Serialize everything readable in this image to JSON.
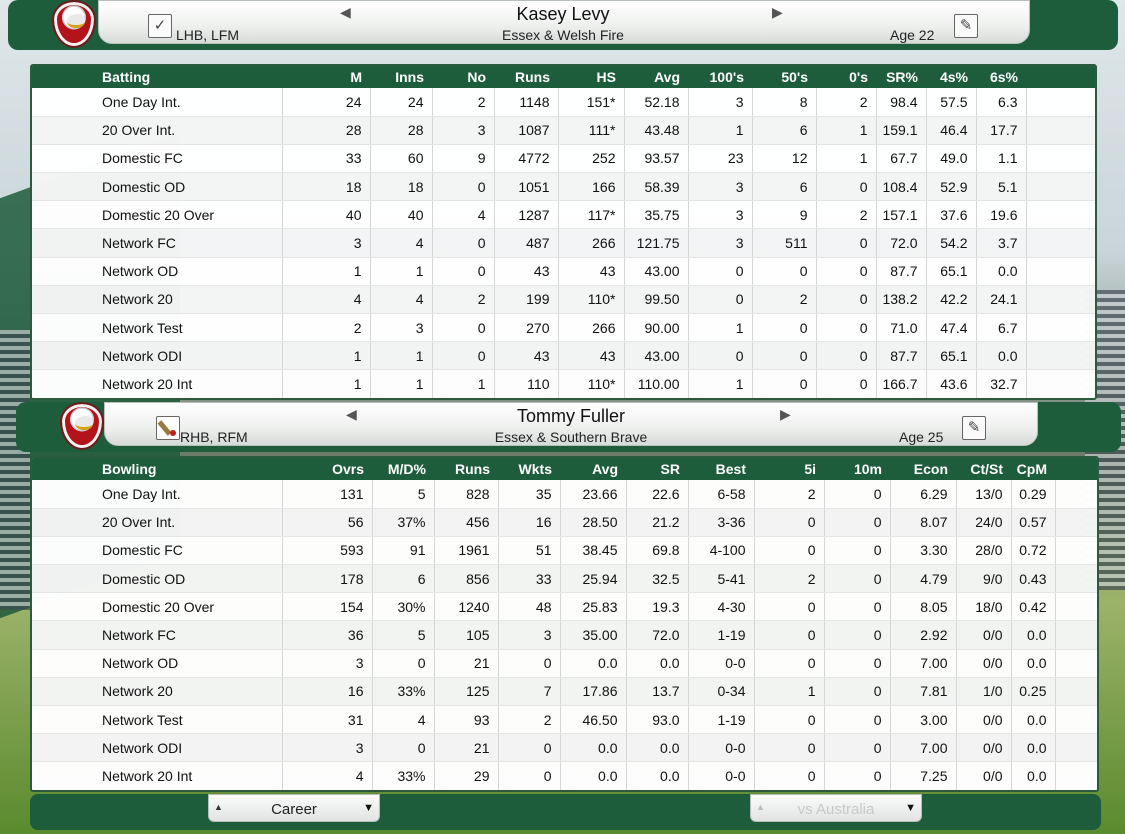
{
  "top_player": {
    "name": "Kasey Levy",
    "team": "Essex & Welsh Fire",
    "hand": "LHB, LFM",
    "age": "Age 22"
  },
  "bottom_player": {
    "name": "Tommy Fuller",
    "team": "Essex & Southern Brave",
    "hand": "RHB, RFM",
    "age": "Age 25"
  },
  "batting": {
    "headers": [
      "Batting",
      "M",
      "Inns",
      "No",
      "Runs",
      "HS",
      "Avg",
      "100's",
      "50's",
      "0's",
      "SR%",
      "4s%",
      "6s%"
    ],
    "rows": [
      [
        "One Day Int.",
        "24",
        "24",
        "2",
        "1148",
        "151*",
        "52.18",
        "3",
        "8",
        "2",
        "98.4",
        "57.5",
        "6.3"
      ],
      [
        "20 Over Int.",
        "28",
        "28",
        "3",
        "1087",
        "111*",
        "43.48",
        "1",
        "6",
        "1",
        "159.1",
        "46.4",
        "17.7"
      ],
      [
        "Domestic FC",
        "33",
        "60",
        "9",
        "4772",
        "252",
        "93.57",
        "23",
        "12",
        "1",
        "67.7",
        "49.0",
        "1.1"
      ],
      [
        "Domestic OD",
        "18",
        "18",
        "0",
        "1051",
        "166",
        "58.39",
        "3",
        "6",
        "0",
        "108.4",
        "52.9",
        "5.1"
      ],
      [
        "Domestic 20 Over",
        "40",
        "40",
        "4",
        "1287",
        "117*",
        "35.75",
        "3",
        "9",
        "2",
        "157.1",
        "37.6",
        "19.6"
      ],
      [
        "Network FC",
        "3",
        "4",
        "0",
        "487",
        "266",
        "121.75",
        "3",
        "511",
        "0",
        "72.0",
        "54.2",
        "3.7"
      ],
      [
        "Network OD",
        "1",
        "1",
        "0",
        "43",
        "43",
        "43.00",
        "0",
        "0",
        "0",
        "87.7",
        "65.1",
        "0.0"
      ],
      [
        "Network 20",
        "4",
        "4",
        "2",
        "199",
        "110*",
        "99.50",
        "0",
        "2",
        "0",
        "138.2",
        "42.2",
        "24.1"
      ],
      [
        "Network Test",
        "2",
        "3",
        "0",
        "270",
        "266",
        "90.00",
        "1",
        "0",
        "0",
        "71.0",
        "47.4",
        "6.7"
      ],
      [
        "Network ODI",
        "1",
        "1",
        "0",
        "43",
        "43",
        "43.00",
        "0",
        "0",
        "0",
        "87.7",
        "65.1",
        "0.0"
      ],
      [
        "Network 20 Int",
        "1",
        "1",
        "1",
        "110",
        "110*",
        "110.00",
        "1",
        "0",
        "0",
        "166.7",
        "43.6",
        "32.7"
      ]
    ]
  },
  "bowling": {
    "headers": [
      "Bowling",
      "Ovrs",
      "M/D%",
      "Runs",
      "Wkts",
      "Avg",
      "SR",
      "Best",
      "5i",
      "10m",
      "Econ",
      "Ct/St",
      "CpM"
    ],
    "rows": [
      [
        "One Day Int.",
        "131",
        "5",
        "828",
        "35",
        "23.66",
        "22.6",
        "6-58",
        "2",
        "0",
        "6.29",
        "13/0",
        "0.29"
      ],
      [
        "20 Over Int.",
        "56",
        "37%",
        "456",
        "16",
        "28.50",
        "21.2",
        "3-36",
        "0",
        "0",
        "8.07",
        "24/0",
        "0.57"
      ],
      [
        "Domestic FC",
        "593",
        "91",
        "1961",
        "51",
        "38.45",
        "69.8",
        "4-100",
        "0",
        "0",
        "3.30",
        "28/0",
        "0.72"
      ],
      [
        "Domestic OD",
        "178",
        "6",
        "856",
        "33",
        "25.94",
        "32.5",
        "5-41",
        "2",
        "0",
        "4.79",
        "9/0",
        "0.43"
      ],
      [
        "Domestic 20 Over",
        "154",
        "30%",
        "1240",
        "48",
        "25.83",
        "19.3",
        "4-30",
        "0",
        "0",
        "8.05",
        "18/0",
        "0.42"
      ],
      [
        "Network FC",
        "36",
        "5",
        "105",
        "3",
        "35.00",
        "72.0",
        "1-19",
        "0",
        "0",
        "2.92",
        "0/0",
        "0.0"
      ],
      [
        "Network OD",
        "3",
        "0",
        "21",
        "0",
        "0.0",
        "0.0",
        "0-0",
        "0",
        "0",
        "7.00",
        "0/0",
        "0.0"
      ],
      [
        "Network 20",
        "16",
        "33%",
        "125",
        "7",
        "17.86",
        "13.7",
        "0-34",
        "1",
        "0",
        "7.81",
        "1/0",
        "0.25"
      ],
      [
        "Network Test",
        "31",
        "4",
        "93",
        "2",
        "46.50",
        "93.0",
        "1-19",
        "0",
        "0",
        "3.00",
        "0/0",
        "0.0"
      ],
      [
        "Network ODI",
        "3",
        "0",
        "21",
        "0",
        "0.0",
        "0.0",
        "0-0",
        "0",
        "0",
        "7.00",
        "0/0",
        "0.0"
      ],
      [
        "Network 20 Int",
        "4",
        "33%",
        "29",
        "0",
        "0.0",
        "0.0",
        "0-0",
        "0",
        "0",
        "7.25",
        "0/0",
        "0.0"
      ]
    ]
  },
  "footer": {
    "left_selector": "Career",
    "right_selector": "vs Australia"
  },
  "icons": {
    "prev": "◀",
    "next": "▶",
    "edit": "✎",
    "up": "▲",
    "down": "▼"
  },
  "colors": {
    "header_green": "#1e5d3c"
  }
}
